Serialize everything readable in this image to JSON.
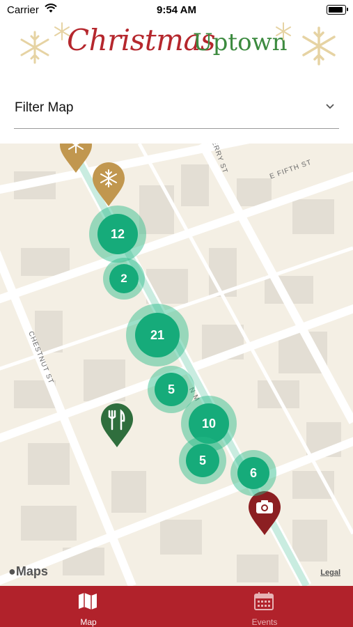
{
  "status_bar": {
    "carrier": "Carrier",
    "time": "9:54 AM"
  },
  "header": {
    "logo_word_1": "Christmas",
    "logo_word_2": "Uptown"
  },
  "filter": {
    "label": "Filter Map"
  },
  "map": {
    "streets": [
      "E FIFTH ST",
      "CHESTNUT ST",
      "N M",
      "ERRY ST"
    ],
    "clusters": [
      {
        "id": "c12",
        "count": "12"
      },
      {
        "id": "c2",
        "count": "2"
      },
      {
        "id": "c21",
        "count": "21"
      },
      {
        "id": "c5a",
        "count": "5"
      },
      {
        "id": "c10",
        "count": "10"
      },
      {
        "id": "c5b",
        "count": "5"
      },
      {
        "id": "c6",
        "count": "6"
      }
    ],
    "pins": [
      {
        "id": "pin-snowflake-top",
        "icon": "snowflake-icon",
        "color": "#c1974f"
      },
      {
        "id": "pin-snowflake",
        "icon": "snowflake-icon",
        "color": "#c1974f"
      },
      {
        "id": "pin-dining",
        "icon": "fork-knife-icon",
        "color": "#2f6e3d"
      },
      {
        "id": "pin-photo",
        "icon": "camera-icon",
        "color": "#8c1f22"
      }
    ],
    "brand": "Maps",
    "legal": "Legal"
  },
  "tabs": [
    {
      "label": "Map",
      "icon": "map-icon",
      "active": true
    },
    {
      "label": "Events",
      "icon": "calendar-icon",
      "active": false
    }
  ],
  "colors": {
    "brand_red": "#b1222b",
    "brand_green": "#3c8a3f",
    "cluster": "#16ab7a",
    "gold": "#c1974f"
  }
}
